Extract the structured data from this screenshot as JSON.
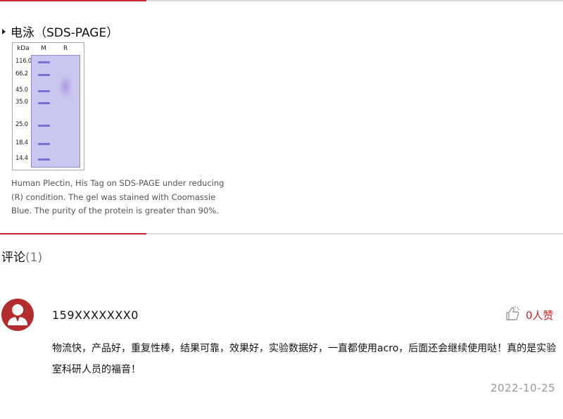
{
  "section": {
    "title": "电泳（SDS-PAGE）"
  },
  "gel": {
    "unit_label": "kDa",
    "lane_marker_label": "M",
    "lane_sample_label": "R",
    "markers": [
      "116.0",
      "66.2",
      "45.0",
      "35.0",
      "25.0",
      "18.4",
      "14.4"
    ],
    "colors": {
      "gel": "#c9c6ef",
      "band": "#7c6fd2"
    }
  },
  "caption": "Human Plectin, His Tag on SDS-PAGE under reducing (R) condition. The gel was stained with Coomassie Blue. The purity of the protein is greater than 90%.",
  "comments": {
    "title": "评论",
    "count": "(1)",
    "items": [
      {
        "user": "159XXXXXXX0",
        "likes": "0人赞",
        "text": "物流快，产品好，重复性棒，结果可靠，效果好，实验数据好，一直都使用acro，后面还会继续使用哒！真的是实验室科研人员的福音！",
        "date": "2022-10-25"
      }
    ]
  },
  "theme": {
    "accent": "#c8282d",
    "avatar_bg": "#b32d2e"
  }
}
